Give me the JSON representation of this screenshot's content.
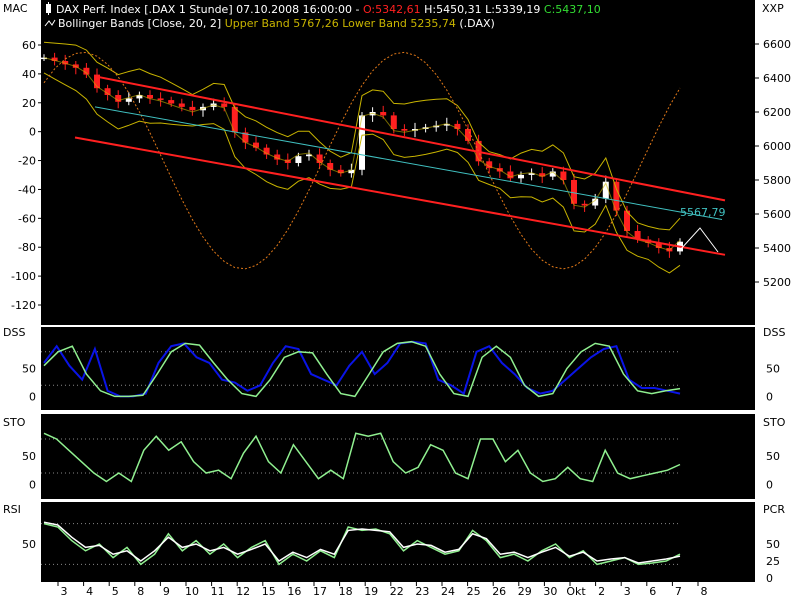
{
  "header": {
    "line1": [
      {
        "text": "DAX Perf. Index [.DAX  1 Stunde] 07.10.2008 16:00:00 - ",
        "color": "#ffffff"
      },
      {
        "text": "O:5342,61",
        "color": "#ff2020"
      },
      {
        "text": " H:5450,31 L:5339,19 ",
        "color": "#ffffff"
      },
      {
        "text": "C:5437,10",
        "color": "#33dd33"
      }
    ],
    "line2": [
      {
        "text": "Bollinger Bands [Close, 20, 2] ",
        "color": "#ffffff"
      },
      {
        "text": "Upper Band 5767,26 Lower Band 5235,74",
        "color": "#c8b400"
      },
      {
        "text": " (.DAX)",
        "color": "#ffffff"
      }
    ],
    "icon1": "candlestick-icon",
    "icon2": "bands-icon"
  },
  "panels": {
    "main": {
      "left_label": "MAC",
      "right_label": "XXP"
    },
    "dss": {
      "left_label": "DSS",
      "right_label": "DSS"
    },
    "sto": {
      "left_label": "STO",
      "right_label": "STO"
    },
    "rsi": {
      "left_label": "RSI",
      "right_label": "PCR"
    }
  },
  "price_annotation": "5567,79",
  "colors": {
    "background": "#000000",
    "frame": "#ffffff",
    "up_candle": "#ffffff",
    "down_candle": "#ff2020",
    "channel": "#ff2020",
    "regression": "#40c0c0",
    "bollinger": "#c8b400",
    "mac": "#e07818",
    "dss_main": "#0a14e6",
    "oscillator": "#90f090",
    "signal": "#ffffff"
  },
  "chart_data": [
    {
      "type": "candlestick",
      "name_prices": "DAX Perf. Index",
      "x_ticks": [
        "3",
        "4",
        "5",
        "8",
        "9",
        "10",
        "11",
        "12",
        "15",
        "16",
        "17",
        "18",
        "19",
        "22",
        "23",
        "24",
        "25",
        "26",
        "29",
        "30",
        "Okt",
        "2",
        "3",
        "6",
        "7",
        "8"
      ],
      "y_left_ticks": [
        60,
        40,
        20,
        0,
        -20,
        -40,
        -60,
        -80,
        -100,
        -120
      ],
      "y_left_range": [
        -120,
        60
      ],
      "y_right_ticks": [
        6600,
        6400,
        6200,
        6000,
        5800,
        5600,
        5400,
        5200
      ],
      "y_right_range": [
        5200,
        6600
      ],
      "approx_close": [
        6520,
        6500,
        6480,
        6460,
        6420,
        6340,
        6300,
        6260,
        6280,
        6300,
        6280,
        6270,
        6250,
        6230,
        6210,
        6230,
        6250,
        6230,
        6080,
        6020,
        5990,
        5950,
        5920,
        5900,
        5940,
        5950,
        5900,
        5860,
        5840,
        5860,
        6180,
        6200,
        6180,
        6100,
        6090,
        6100,
        6110,
        6120,
        6130,
        6100,
        6030,
        5910,
        5870,
        5850,
        5810,
        5830,
        5840,
        5820,
        5850,
        5800,
        5660,
        5650,
        5690,
        5790,
        5620,
        5500,
        5450,
        5430,
        5400,
        5380,
        5437
      ],
      "channel_upper": [
        [
          6410,
          5680
        ]
      ],
      "channel_lower": [
        [
          6050,
          5360
        ]
      ],
      "regression_line": [
        [
          6230,
          5567.79
        ]
      ]
    },
    {
      "type": "line",
      "title": "DSS",
      "y_ticks": [
        50,
        0
      ],
      "y_range": [
        -10,
        110
      ],
      "series": [
        {
          "color_key": "dss_main",
          "values": [
            60,
            90,
            55,
            30,
            85,
            10,
            0,
            0,
            5,
            60,
            90,
            95,
            70,
            60,
            30,
            25,
            10,
            20,
            60,
            90,
            85,
            40,
            30,
            20,
            55,
            80,
            40,
            60,
            95,
            98,
            95,
            30,
            20,
            5,
            80,
            90,
            60,
            40,
            15,
            5,
            10,
            30,
            50,
            70,
            85,
            90,
            30,
            15,
            15,
            10,
            5
          ]
        },
        {
          "color_key": "oscillator",
          "values": [
            55,
            80,
            90,
            40,
            10,
            0,
            0,
            2,
            40,
            80,
            95,
            92,
            60,
            30,
            5,
            0,
            30,
            70,
            80,
            78,
            40,
            5,
            0,
            40,
            80,
            95,
            98,
            90,
            40,
            5,
            0,
            70,
            90,
            70,
            20,
            0,
            5,
            50,
            80,
            95,
            90,
            40,
            10,
            5,
            10,
            14
          ]
        }
      ]
    },
    {
      "type": "line",
      "title": "STO",
      "y_ticks": [
        50,
        0
      ],
      "y_range": [
        -10,
        110
      ],
      "series": [
        {
          "color_key": "oscillator",
          "values": [
            90,
            80,
            60,
            40,
            20,
            5,
            20,
            5,
            60,
            85,
            60,
            75,
            40,
            20,
            25,
            10,
            55,
            85,
            40,
            20,
            70,
            40,
            10,
            25,
            10,
            90,
            85,
            90,
            40,
            20,
            30,
            70,
            60,
            20,
            10,
            80,
            80,
            40,
            60,
            20,
            5,
            10,
            30,
            10,
            5,
            60,
            20,
            10,
            15,
            20,
            25,
            35
          ]
        }
      ]
    },
    {
      "type": "line",
      "title": "RSI",
      "y_left_ticks": [
        50
      ],
      "y_right_ticks": [
        50,
        25,
        0
      ],
      "y_range": [
        0,
        100
      ],
      "series": [
        {
          "color_key": "oscillator",
          "values": [
            80,
            75,
            55,
            40,
            50,
            30,
            45,
            20,
            35,
            65,
            40,
            55,
            35,
            50,
            30,
            45,
            55,
            20,
            35,
            25,
            40,
            30,
            75,
            70,
            72,
            65,
            40,
            55,
            45,
            35,
            40,
            70,
            55,
            30,
            35,
            25,
            40,
            50,
            30,
            40,
            20,
            25,
            30,
            20,
            22,
            25,
            35
          ]
        },
        {
          "color_key": "signal",
          "values": [
            82,
            78,
            60,
            45,
            48,
            35,
            40,
            25,
            40,
            60,
            45,
            50,
            40,
            45,
            35,
            42,
            50,
            25,
            38,
            30,
            42,
            35,
            70,
            72,
            70,
            68,
            45,
            50,
            48,
            38,
            42,
            65,
            58,
            35,
            38,
            30,
            38,
            45,
            32,
            38,
            25,
            28,
            30,
            22,
            25,
            28,
            32
          ]
        }
      ]
    }
  ]
}
